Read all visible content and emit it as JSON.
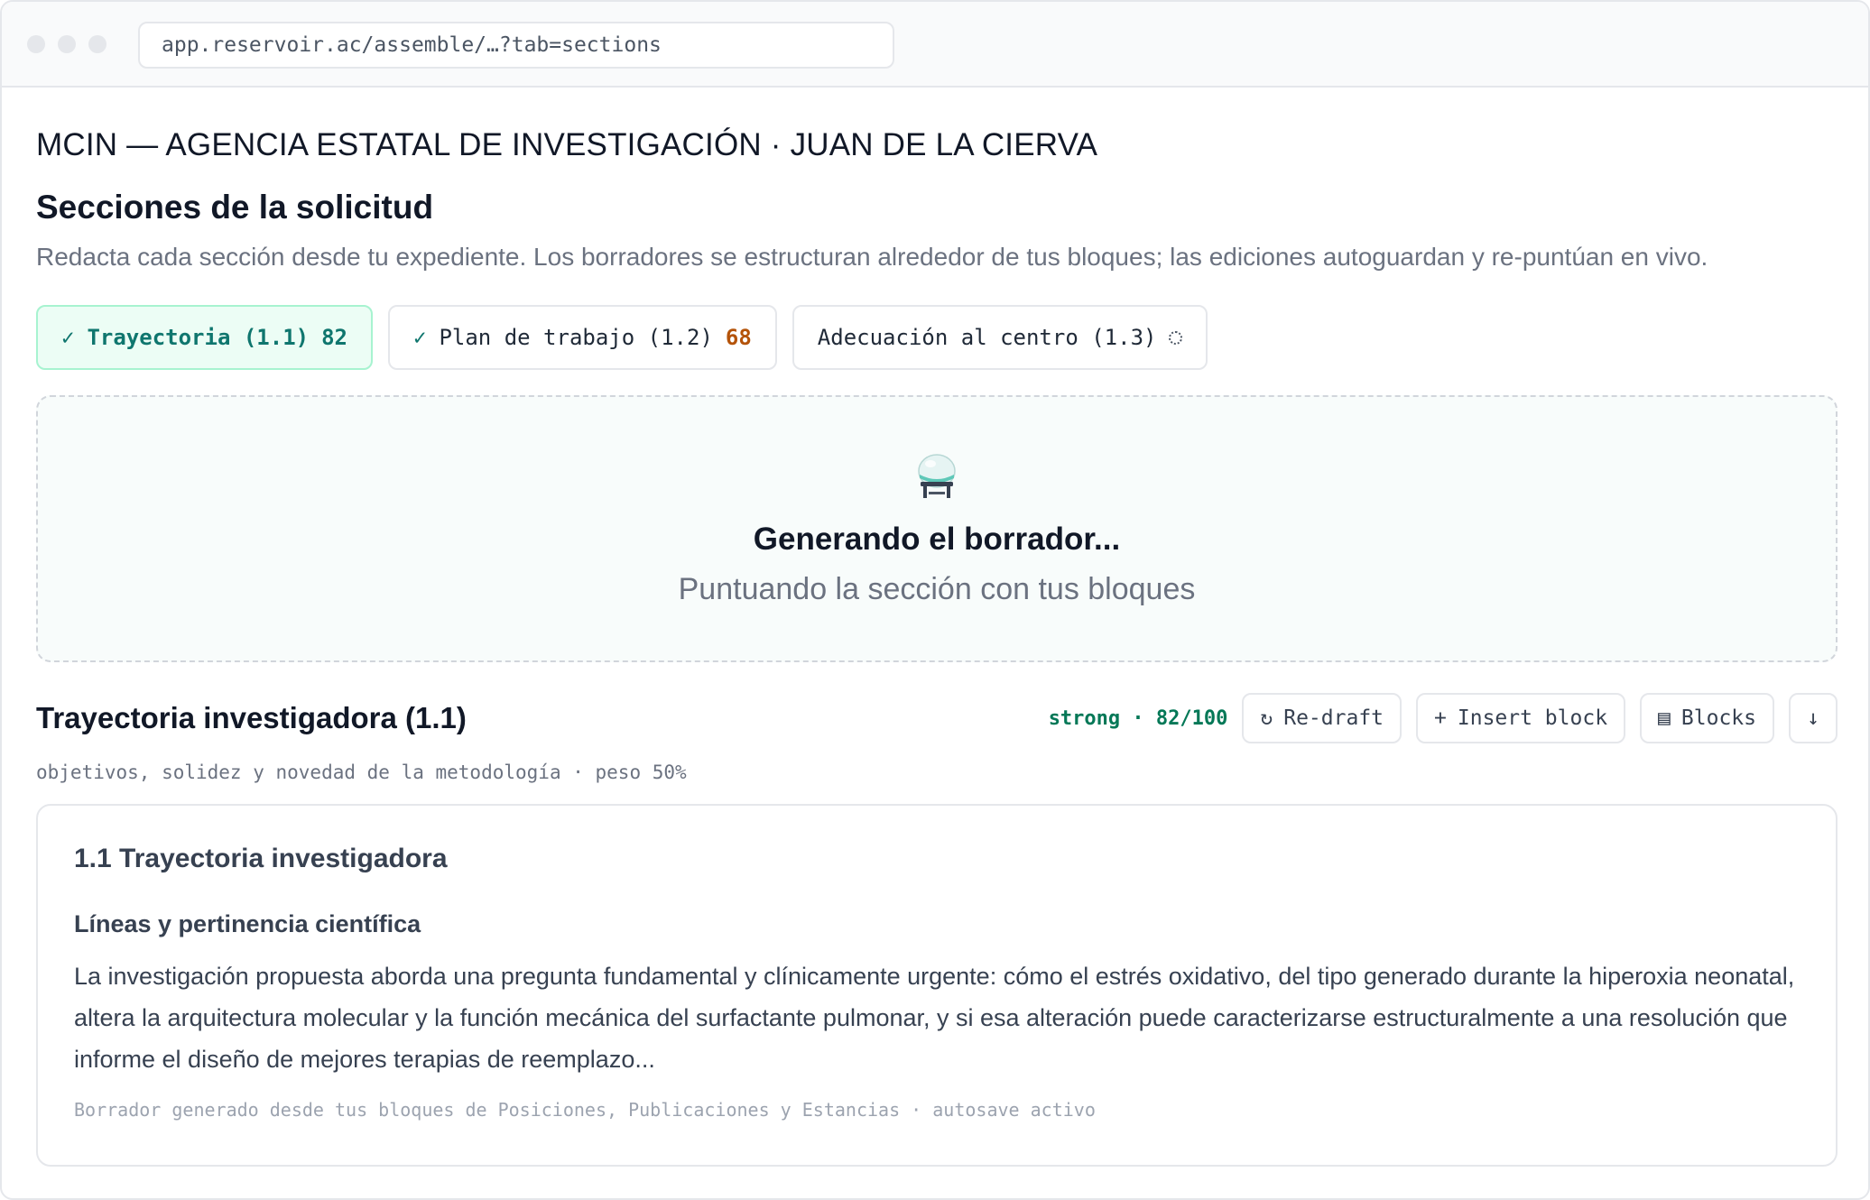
{
  "browser": {
    "url": "app.reservoir.ac/assemble/…?tab=sections"
  },
  "header": {
    "agency": "MCIN — AGENCIA ESTATAL DE INVESTIGACIÓN · JUAN DE LA CIERVA",
    "title": "Secciones de la solicitud",
    "subtitle": "Redacta cada sección desde tu expediente. Los borradores se estructuran alrededor de tus bloques; las ediciones autoguardan y re-puntúan en vivo."
  },
  "tabs": [
    {
      "check": "✓",
      "label": "Trayectoria (1.1)",
      "score": "82",
      "state": "active"
    },
    {
      "check": "✓",
      "label": "Plan de trabajo (1.2)",
      "score": "68",
      "state": "done"
    },
    {
      "label": "Adecuación al centro (1.3)",
      "state": "loading"
    }
  ],
  "generating": {
    "icon": "flask-icon",
    "title": "Generando el borrador...",
    "subtitle": "Puntuando la sección con tus bloques"
  },
  "section": {
    "title": "Trayectoria investigadora (1.1)",
    "strength": "strong · 82/100",
    "criteria": "objetivos, solidez y novedad de la metodología · peso 50%",
    "buttons": {
      "redraft_icon": "↻",
      "redraft": "Re-draft",
      "insert_icon": "+",
      "insert": "Insert block",
      "blocks_icon": "▤",
      "blocks": "Blocks",
      "download_icon": "↓"
    }
  },
  "draft": {
    "heading": "1.1 Trayectoria investigadora",
    "subheading": "Líneas y pertinencia científica",
    "body": "La investigación propuesta aborda una pregunta fundamental y clínicamente urgente: cómo el estrés oxidativo, del tipo generado durante la hiperoxia neonatal, altera la arquitectura molecular y la función mecánica del surfactante pulmonar, y si esa alteración puede caracterizarse estructuralmente a una resolución que informe el diseño de mejores terapias de reemplazo...",
    "footer": "Borrador generado desde tus bloques de Posiciones, Publicaciones y Estancias · autosave activo"
  },
  "colors": {
    "accent": "#0f766e",
    "warn": "#b45309",
    "strong": "#047857"
  }
}
